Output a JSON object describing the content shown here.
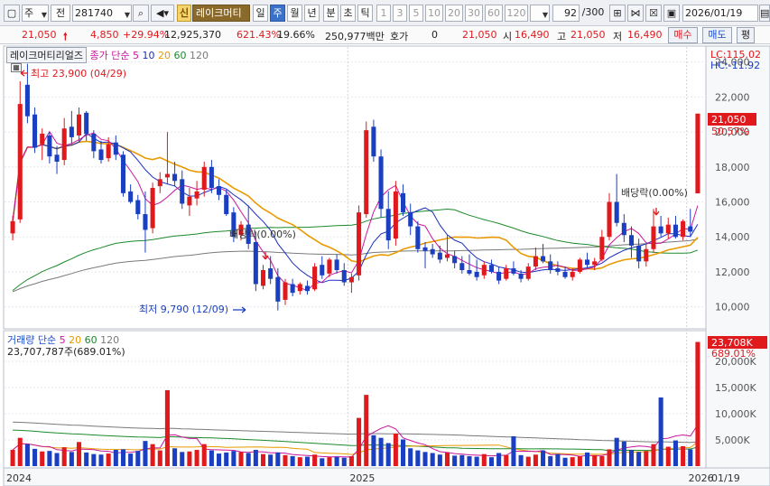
{
  "toolbar": {
    "market_label": "주",
    "type_label": "전",
    "code": "281740",
    "shin_label": "신",
    "stock_name": "레이크머티",
    "periods": [
      "일",
      "주",
      "월",
      "년"
    ],
    "period_selected": "주",
    "intraday": [
      "분",
      "초",
      "틱"
    ],
    "minutes": [
      "1",
      "3",
      "5",
      "10",
      "20",
      "30",
      "60",
      "120"
    ],
    "count": "92",
    "count_total": "/300",
    "date": "2026/01/19"
  },
  "quote": {
    "price": "21,050",
    "change": "4,850",
    "change_pct": "+29.94%",
    "volume": "12,925,370",
    "volume_ratio": "621.43%",
    "turnover": "19.66%",
    "amount": "250,977백만",
    "hoga_label": "호가",
    "hoga_value": "0",
    "price2": "21,050",
    "open_label": "시",
    "open": "16,490",
    "high_label": "고",
    "high": "21,050",
    "low_label": "저",
    "low": "16,490",
    "buy_label": "매수",
    "sell_label": "매도",
    "eval_label": "평"
  },
  "price_panel": {
    "stock_title": "레이크머티리얼즈",
    "ma_title": "종가 단순",
    "ma_periods": [
      "5",
      "10",
      "20",
      "60",
      "120"
    ],
    "ma_colors": [
      "#c8179c",
      "#1a2fc0",
      "#e89a00",
      "#1c8a2a",
      "#7a7a7a"
    ],
    "lc": "LC:115.02",
    "hc": "HC:-11.92",
    "high_note": "최고 23,900 (04/29)",
    "low_note": "최저 9,790 (12/09)",
    "div_note1": "배당락(0.00%)",
    "div_note2": "배당락(0.00%)",
    "last_price_label": "21,050",
    "last_pct_label": "50.57%",
    "y_ticks": [
      "24,000",
      "22,000",
      "20,000",
      "18,000",
      "16,000",
      "14,000",
      "12,000",
      "10,000"
    ]
  },
  "volume_panel": {
    "title": "거래량 단순",
    "ma_periods": [
      "5",
      "20",
      "60",
      "120"
    ],
    "ma_colors": [
      "#c8179c",
      "#e89a00",
      "#1c8a2a",
      "#7a7a7a"
    ],
    "value_line": "23,707,787주(689.01%)",
    "last_label": "23,708K",
    "last_pct": "689.01%",
    "y_ticks": [
      "20,000K",
      "15,000K",
      "10,000K",
      "5,000K"
    ]
  },
  "x_axis": {
    "labels": [
      "2024",
      "2025",
      "2026"
    ],
    "right_label": "01/19"
  },
  "colors": {
    "up": "#e0191d",
    "down": "#1a3fc0",
    "price_box": "#e0191d"
  },
  "chart_data": {
    "type": "candlestick",
    "price_series": [
      {
        "o": 14200,
        "h": 15200,
        "l": 13800,
        "c": 14900
      },
      {
        "o": 15000,
        "h": 22900,
        "l": 14800,
        "c": 21600
      },
      {
        "o": 22700,
        "h": 23900,
        "l": 20500,
        "c": 20900
      },
      {
        "o": 21000,
        "h": 21400,
        "l": 18800,
        "c": 19100
      },
      {
        "o": 19300,
        "h": 20200,
        "l": 18400,
        "c": 19900
      },
      {
        "o": 19800,
        "h": 20000,
        "l": 18200,
        "c": 18600
      },
      {
        "o": 18700,
        "h": 19200,
        "l": 17600,
        "c": 18300
      },
      {
        "o": 18400,
        "h": 20800,
        "l": 18100,
        "c": 20200
      },
      {
        "o": 20300,
        "h": 21200,
        "l": 19300,
        "c": 19700
      },
      {
        "o": 19800,
        "h": 21400,
        "l": 19400,
        "c": 21000
      },
      {
        "o": 21100,
        "h": 21200,
        "l": 19500,
        "c": 19900
      },
      {
        "o": 19900,
        "h": 20100,
        "l": 18500,
        "c": 18900
      },
      {
        "o": 19000,
        "h": 19500,
        "l": 18200,
        "c": 18400
      },
      {
        "o": 18500,
        "h": 19700,
        "l": 18300,
        "c": 19300
      },
      {
        "o": 19400,
        "h": 19800,
        "l": 18400,
        "c": 18700
      },
      {
        "o": 18700,
        "h": 18900,
        "l": 16300,
        "c": 16500
      },
      {
        "o": 16600,
        "h": 17000,
        "l": 15900,
        "c": 16000
      },
      {
        "o": 16100,
        "h": 16400,
        "l": 15000,
        "c": 15300
      },
      {
        "o": 15300,
        "h": 16600,
        "l": 13100,
        "c": 14400
      },
      {
        "o": 14500,
        "h": 17100,
        "l": 14200,
        "c": 16800
      },
      {
        "o": 16900,
        "h": 17700,
        "l": 16500,
        "c": 17300
      },
      {
        "o": 17400,
        "h": 20000,
        "l": 17000,
        "c": 17600
      },
      {
        "o": 17600,
        "h": 18300,
        "l": 16900,
        "c": 17200
      },
      {
        "o": 17300,
        "h": 17800,
        "l": 15600,
        "c": 15900
      },
      {
        "o": 15800,
        "h": 16800,
        "l": 15200,
        "c": 16300
      },
      {
        "o": 16200,
        "h": 17200,
        "l": 15800,
        "c": 16600
      },
      {
        "o": 16700,
        "h": 18300,
        "l": 16300,
        "c": 18000
      },
      {
        "o": 18000,
        "h": 18400,
        "l": 16500,
        "c": 16800
      },
      {
        "o": 16900,
        "h": 17300,
        "l": 16100,
        "c": 16400
      },
      {
        "o": 16400,
        "h": 16700,
        "l": 15200,
        "c": 15300
      },
      {
        "o": 15400,
        "h": 15700,
        "l": 13700,
        "c": 14000
      },
      {
        "o": 14100,
        "h": 14900,
        "l": 13800,
        "c": 14700
      },
      {
        "o": 14700,
        "h": 15800,
        "l": 13300,
        "c": 13600
      },
      {
        "o": 13700,
        "h": 14300,
        "l": 10900,
        "c": 11300
      },
      {
        "o": 11200,
        "h": 12400,
        "l": 11000,
        "c": 12100
      },
      {
        "o": 12200,
        "h": 12900,
        "l": 11300,
        "c": 11600
      },
      {
        "o": 11700,
        "h": 12200,
        "l": 9790,
        "c": 10300
      },
      {
        "o": 10400,
        "h": 11600,
        "l": 10100,
        "c": 11400
      },
      {
        "o": 11300,
        "h": 11600,
        "l": 10600,
        "c": 10800
      },
      {
        "o": 10900,
        "h": 11400,
        "l": 10700,
        "c": 11300
      },
      {
        "o": 11200,
        "h": 11500,
        "l": 10700,
        "c": 10900
      },
      {
        "o": 11000,
        "h": 12500,
        "l": 10900,
        "c": 12300
      },
      {
        "o": 12400,
        "h": 12900,
        "l": 11600,
        "c": 11800
      },
      {
        "o": 11900,
        "h": 12800,
        "l": 11700,
        "c": 12700
      },
      {
        "o": 12700,
        "h": 13000,
        "l": 11900,
        "c": 12100
      },
      {
        "o": 12100,
        "h": 12500,
        "l": 11200,
        "c": 11400
      },
      {
        "o": 11400,
        "h": 11900,
        "l": 10800,
        "c": 11700
      },
      {
        "o": 11800,
        "h": 15800,
        "l": 11500,
        "c": 15400
      },
      {
        "o": 15300,
        "h": 20600,
        "l": 15100,
        "c": 20100
      },
      {
        "o": 20300,
        "h": 20700,
        "l": 18300,
        "c": 18600
      },
      {
        "o": 18600,
        "h": 19000,
        "l": 15100,
        "c": 15600
      },
      {
        "o": 15600,
        "h": 16600,
        "l": 13300,
        "c": 13800
      },
      {
        "o": 13900,
        "h": 17200,
        "l": 13500,
        "c": 16600
      },
      {
        "o": 16500,
        "h": 17000,
        "l": 15200,
        "c": 15400
      },
      {
        "o": 15400,
        "h": 15900,
        "l": 14100,
        "c": 14600
      },
      {
        "o": 14600,
        "h": 14900,
        "l": 13100,
        "c": 13300
      },
      {
        "o": 13400,
        "h": 13700,
        "l": 12200,
        "c": 13200
      },
      {
        "o": 13300,
        "h": 13600,
        "l": 12800,
        "c": 13000
      },
      {
        "o": 13100,
        "h": 13500,
        "l": 12500,
        "c": 12700
      },
      {
        "o": 12800,
        "h": 14100,
        "l": 12600,
        "c": 13000
      },
      {
        "o": 12900,
        "h": 13200,
        "l": 12200,
        "c": 12500
      },
      {
        "o": 12500,
        "h": 12900,
        "l": 11900,
        "c": 12100
      },
      {
        "o": 12100,
        "h": 13000,
        "l": 11800,
        "c": 11900
      },
      {
        "o": 12000,
        "h": 12700,
        "l": 11500,
        "c": 11700
      },
      {
        "o": 11800,
        "h": 12600,
        "l": 11600,
        "c": 12400
      },
      {
        "o": 12400,
        "h": 12700,
        "l": 11900,
        "c": 12000
      },
      {
        "o": 12000,
        "h": 12300,
        "l": 11300,
        "c": 11500
      },
      {
        "o": 11600,
        "h": 12400,
        "l": 11500,
        "c": 12200
      },
      {
        "o": 12200,
        "h": 12600,
        "l": 11800,
        "c": 11900
      },
      {
        "o": 11900,
        "h": 12100,
        "l": 11400,
        "c": 11600
      },
      {
        "o": 11600,
        "h": 12500,
        "l": 11500,
        "c": 12300
      },
      {
        "o": 12300,
        "h": 13400,
        "l": 12100,
        "c": 12900
      },
      {
        "o": 12900,
        "h": 13600,
        "l": 12500,
        "c": 12600
      },
      {
        "o": 12600,
        "h": 13000,
        "l": 11900,
        "c": 12100
      },
      {
        "o": 12200,
        "h": 12600,
        "l": 11800,
        "c": 12000
      },
      {
        "o": 12000,
        "h": 12300,
        "l": 11600,
        "c": 11700
      },
      {
        "o": 11700,
        "h": 12200,
        "l": 11500,
        "c": 12000
      },
      {
        "o": 12000,
        "h": 12800,
        "l": 11900,
        "c": 12700
      },
      {
        "o": 12700,
        "h": 13100,
        "l": 12200,
        "c": 12400
      },
      {
        "o": 12400,
        "h": 12800,
        "l": 12100,
        "c": 12600
      },
      {
        "o": 12700,
        "h": 14400,
        "l": 12600,
        "c": 14000
      },
      {
        "o": 14000,
        "h": 16500,
        "l": 13800,
        "c": 16000
      },
      {
        "o": 16000,
        "h": 17600,
        "l": 14600,
        "c": 14800
      },
      {
        "o": 14800,
        "h": 15300,
        "l": 13700,
        "c": 14100
      },
      {
        "o": 14100,
        "h": 14600,
        "l": 12800,
        "c": 13500
      },
      {
        "o": 13500,
        "h": 13900,
        "l": 12200,
        "c": 12600
      },
      {
        "o": 12600,
        "h": 13600,
        "l": 12300,
        "c": 13300
      },
      {
        "o": 13300,
        "h": 15600,
        "l": 13100,
        "c": 14600
      },
      {
        "o": 14600,
        "h": 15200,
        "l": 14000,
        "c": 14200
      },
      {
        "o": 14200,
        "h": 15100,
        "l": 13900,
        "c": 14700
      },
      {
        "o": 14700,
        "h": 15200,
        "l": 13900,
        "c": 14000
      },
      {
        "o": 14000,
        "h": 15000,
        "l": 13800,
        "c": 14900
      },
      {
        "o": 14600,
        "h": 15600,
        "l": 14000,
        "c": 14300
      },
      {
        "o": 16490,
        "h": 21050,
        "l": 16490,
        "c": 21050
      }
    ],
    "volume_series": [
      3.1,
      5.4,
      4.2,
      3.3,
      2.8,
      2.9,
      2.5,
      3.6,
      2.7,
      4.6,
      2.6,
      2.3,
      2.2,
      2.4,
      3.1,
      3.2,
      2.4,
      2.9,
      4.8,
      4.2,
      3.0,
      14.5,
      3.4,
      2.7,
      2.8,
      3.1,
      4.2,
      3.0,
      2.4,
      2.6,
      2.9,
      2.7,
      2.5,
      3.1,
      2.3,
      2.2,
      2.6,
      2.1,
      1.9,
      1.7,
      1.8,
      2.2,
      1.5,
      1.7,
      1.8,
      1.6,
      1.9,
      9.2,
      13.6,
      5.9,
      5.4,
      4.4,
      6.2,
      5.1,
      3.4,
      3.0,
      2.7,
      2.5,
      2.2,
      2.6,
      2.0,
      2.1,
      1.9,
      1.8,
      2.3,
      1.7,
      2.5,
      2.1,
      5.7,
      2.1,
      1.8,
      2.2,
      3.0,
      1.9,
      2.3,
      1.6,
      1.7,
      1.9,
      2.6,
      2.1,
      1.9,
      3.2,
      5.4,
      4.7,
      3.1,
      2.7,
      2.9,
      4.2,
      13.1,
      3.7,
      4.9,
      3.8,
      3.2,
      23.7
    ],
    "x_labels": [
      "2024",
      "2025",
      "2026"
    ],
    "y_range": [
      9000,
      24500
    ],
    "volume_range_k": [
      0,
      25000
    ]
  }
}
